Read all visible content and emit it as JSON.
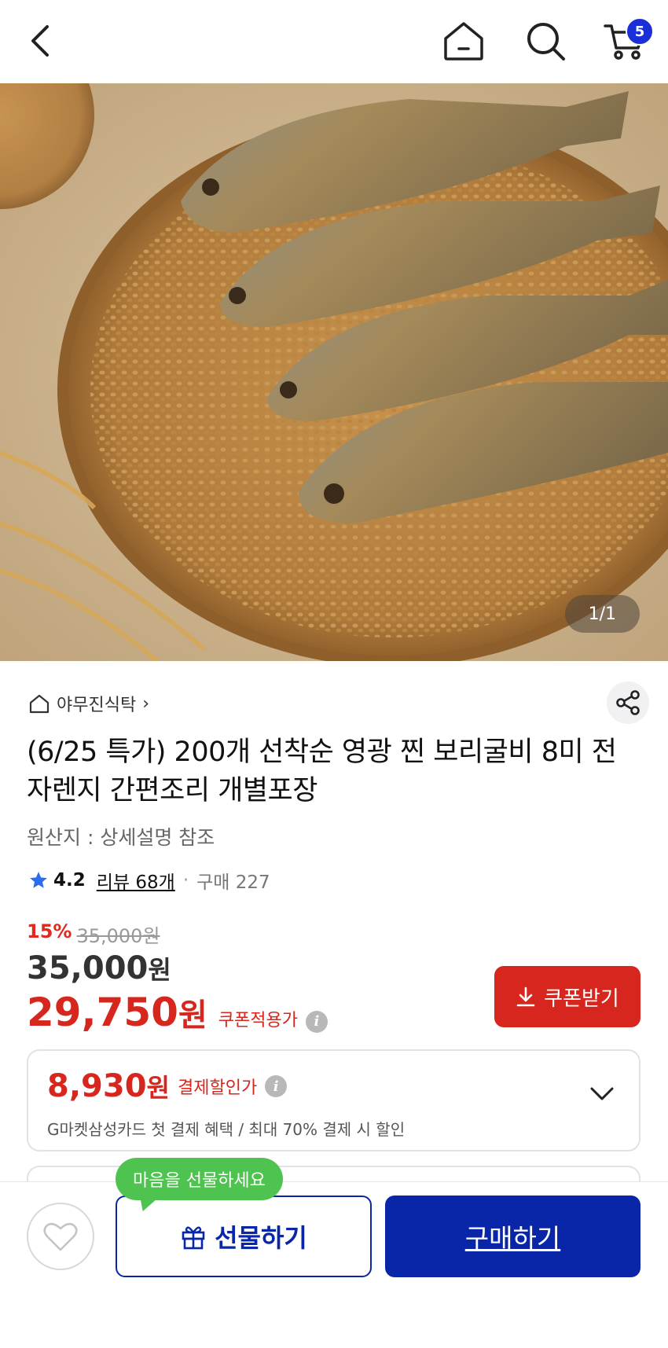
{
  "nav": {
    "cart_count": "5"
  },
  "gallery": {
    "indicator": "1/1",
    "image_alt": "dried yellow croaker fish on barley in a woven bamboo basket"
  },
  "product": {
    "shop_name": "야무진식탁",
    "shop_arrow": "›",
    "title": "(6/25 특가) 200개 선착순 영광 찐 보리굴비 8미 전자렌지 간편조리 개별포장",
    "origin": "원산지 : 상세설명 참조",
    "rating": "4.2",
    "review_label": "리뷰 68개",
    "dot": "·",
    "purchase_label": "구매 227"
  },
  "price": {
    "discount_rate": "15%",
    "original_price": "35,000원",
    "sale_price": "35,000",
    "sale_unit": "원",
    "coupon_price": "29,750",
    "coupon_unit": "원",
    "coupon_label": "쿠폰적용가",
    "coupon_button": "쿠폰받기"
  },
  "payment": {
    "price": "8,930",
    "unit": "원",
    "label": "결제할인가",
    "description": "G마켓삼성카드 첫 결제 혜택 / 최대 70% 결제 시 할인"
  },
  "bottom": {
    "tooltip": "마음을 선물하세요",
    "gift_button": "선물하기",
    "buy_button": "구매하기"
  },
  "colors": {
    "brand_blue": "#0a26a8",
    "sale_red": "#d7261d",
    "tooltip_green": "#4fc34f",
    "badge_blue": "#1a2fd6"
  }
}
